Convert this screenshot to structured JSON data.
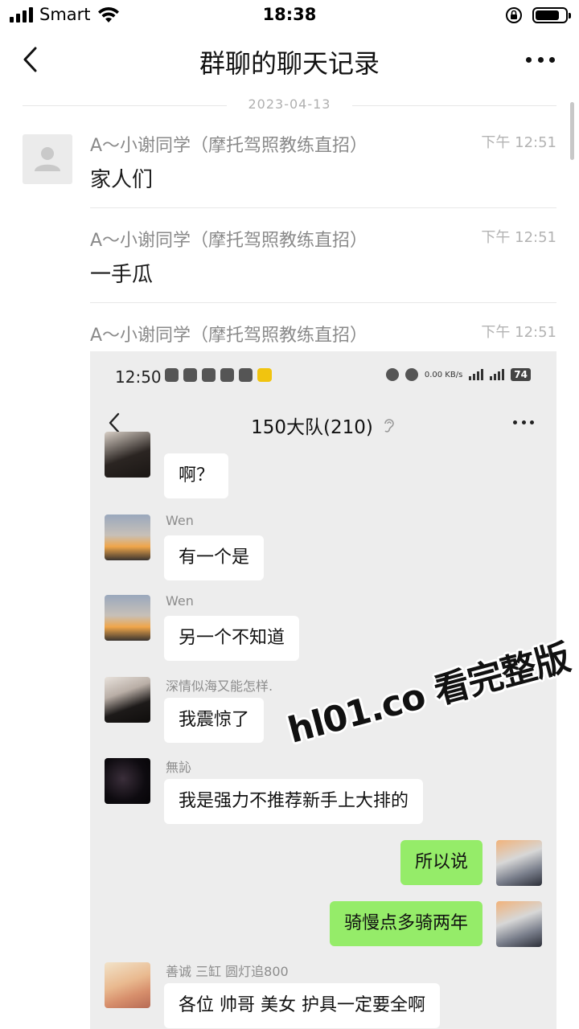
{
  "status_bar": {
    "carrier": "Smart",
    "time": "18:38"
  },
  "nav": {
    "title": "群聊的聊天记录"
  },
  "date_divider": "2023-04-13",
  "messages": [
    {
      "sender": "A～小谢同学（摩托驾照教练直招）",
      "time": "下午 12:51",
      "text": "家人们"
    },
    {
      "sender": "A～小谢同学（摩托驾照教练直招）",
      "time": "下午 12:51",
      "text": "一手瓜"
    },
    {
      "sender": "A～小谢同学（摩托驾照教练直招）",
      "time": "下午 12:51",
      "text": ""
    }
  ],
  "embedded": {
    "status_time": "12:50",
    "status_extra": "0.00 KB/s",
    "battery": "74",
    "title": "150大队(210)",
    "chat": [
      {
        "sender": "",
        "text": "啊？",
        "me": false
      },
      {
        "sender": "Wen",
        "text": "有一个是",
        "me": false
      },
      {
        "sender": "Wen",
        "text": "另一个不知道",
        "me": false
      },
      {
        "sender": "深情似海又能怎样.",
        "text": "我震惊了",
        "me": false
      },
      {
        "sender": "無訫",
        "text": "我是强力不推荐新手上大排的",
        "me": false
      },
      {
        "sender": "",
        "text": "所以说",
        "me": true
      },
      {
        "sender": "",
        "text": "骑慢点多骑两年",
        "me": true
      },
      {
        "sender": "善诚 三缸 圆灯追800",
        "text": "各位 帅哥 美女 护具一定要全啊",
        "me": false
      }
    ]
  },
  "watermark": "hl01.co 看完整版"
}
